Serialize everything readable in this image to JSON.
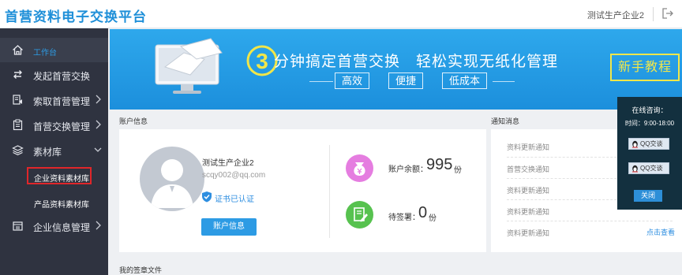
{
  "header": {
    "title": "首营资料电子交换平台",
    "user_name": "测试生产企业2",
    "logout_icon": "logout-icon"
  },
  "sidebar": {
    "items": [
      {
        "label": "工作台",
        "icon": "home-icon",
        "active": true
      },
      {
        "label": "发起首营交换",
        "icon": "exchange-icon"
      },
      {
        "label": "索取首营管理",
        "icon": "request-icon",
        "expandable": true
      },
      {
        "label": "首营交换管理",
        "icon": "clipboard-icon",
        "expandable": true
      },
      {
        "label": "素材库",
        "icon": "layers-icon",
        "expanded": true
      },
      {
        "label": "企业信息管理",
        "icon": "enterprise-icon",
        "expandable": true
      }
    ],
    "sub_items": [
      {
        "label": "企业资料素材库",
        "highlighted": true
      },
      {
        "label": "产品资料素材库"
      }
    ]
  },
  "banner": {
    "number": "3",
    "slogan": "分钟搞定首营交换　轻松实现无纸化管理",
    "tags": [
      "高效",
      "便捷",
      "低成本"
    ],
    "tutorial_label": "新手教程",
    "accent_color": "#f1e64a"
  },
  "account": {
    "section_title": "账户信息",
    "name": "测试生产企业2",
    "email": "scqy002@qq.com",
    "cert_status": "证书已认证",
    "button_label": "账户信息",
    "balance_label": "账户余额：",
    "balance_value": "995",
    "balance_unit": "份",
    "pending_label": "待签署：",
    "pending_value": "0",
    "pending_unit": "份"
  },
  "notices": {
    "section_title": "通知消息",
    "items": [
      "资料更新通知",
      "首营交换通知",
      "资料更新通知",
      "资料更新通知",
      "资料更新通知"
    ],
    "more_label": "点击查看"
  },
  "consult": {
    "title": "在线咨询：",
    "time": "时间：9:00-18:00",
    "qq_buttons": [
      "QQ交谈",
      "QQ交谈"
    ],
    "close_label": "关闭"
  },
  "signed_section": {
    "title": "我的签章文件"
  }
}
